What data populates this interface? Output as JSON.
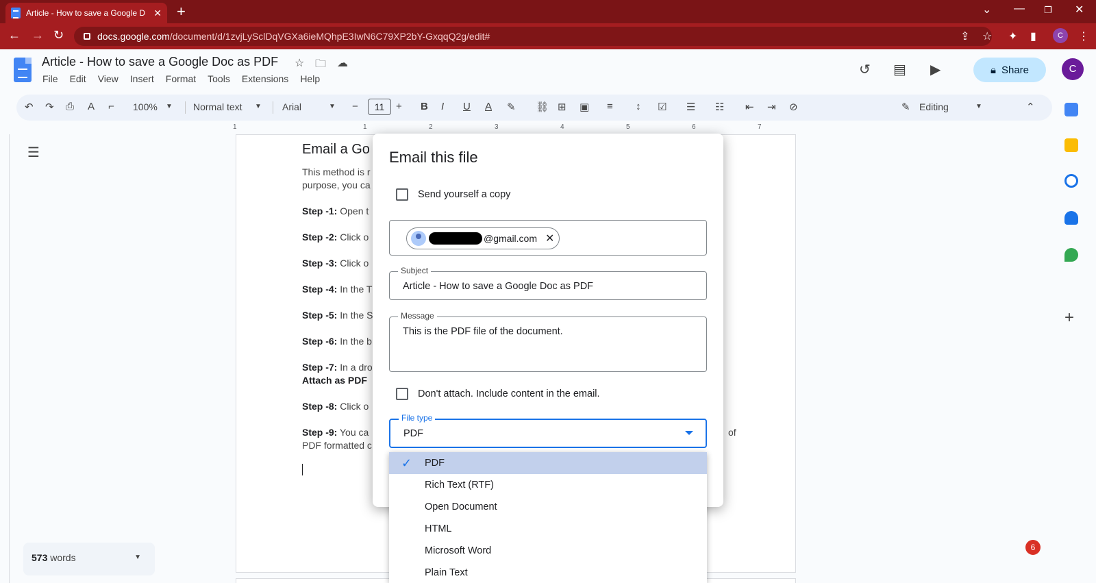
{
  "browser": {
    "tab_title": "Article - How to save a Google D",
    "url_host": "docs.google.com",
    "url_path": "/document/d/1zvjLySclDqVGXa6ieMQhpE3IwN6C79XP2bY-GxqqQ2g/edit#",
    "profile_initial": "C"
  },
  "docs": {
    "title": "Article - How to save a Google Doc as PDF",
    "menu": [
      "File",
      "Edit",
      "View",
      "Insert",
      "Format",
      "Tools",
      "Extensions",
      "Help"
    ],
    "share_label": "Share",
    "avatar_initial": "C"
  },
  "toolbar": {
    "zoom": "100%",
    "style": "Normal text",
    "font": "Arial",
    "font_size": "11",
    "mode": "Editing"
  },
  "ruler": [
    "1",
    "1",
    "2",
    "3",
    "4",
    "5",
    "6",
    "7"
  ],
  "document": {
    "heading": "Email a Go",
    "intro_1": "This method is r",
    "intro_2": "purpose, you ca",
    "steps": [
      {
        "label": "Step -1:",
        "text": " Open t"
      },
      {
        "label": "Step -2:",
        "text": " Click o"
      },
      {
        "label": "Step -3:",
        "text": " Click o"
      },
      {
        "label": "Step -4:",
        "text": " In the T"
      },
      {
        "label": "Step -5:",
        "text": " In the S"
      },
      {
        "label": "Step -6:",
        "text": " In the b"
      },
      {
        "label": "Step -7:",
        "text": " In a dro"
      },
      {
        "label": "Step -8:",
        "text": " Click o"
      },
      {
        "label": "Step -9:",
        "text": " You ca"
      }
    ],
    "step7_line2": "Attach as PDF",
    "step9_line2": "PDF formatted c",
    "step9_tail": "of"
  },
  "word_count": {
    "count": "573",
    "label": " words"
  },
  "notification_count": "6",
  "dialog": {
    "title": "Email this file",
    "send_copy_label": "Send yourself a copy",
    "recipient_suffix": "@gmail.com",
    "subject_label": "Subject",
    "subject_value": "Article - How to save a Google Doc as PDF",
    "message_label": "Message",
    "message_value": "This is the PDF file of the document.",
    "dont_attach_label": "Don't attach. Include content in the email.",
    "file_type_label": "File type",
    "file_type_value": "PDF"
  },
  "file_type_options": [
    "PDF",
    "Rich Text (RTF)",
    "Open Document",
    "HTML",
    "Microsoft Word",
    "Plain Text"
  ]
}
